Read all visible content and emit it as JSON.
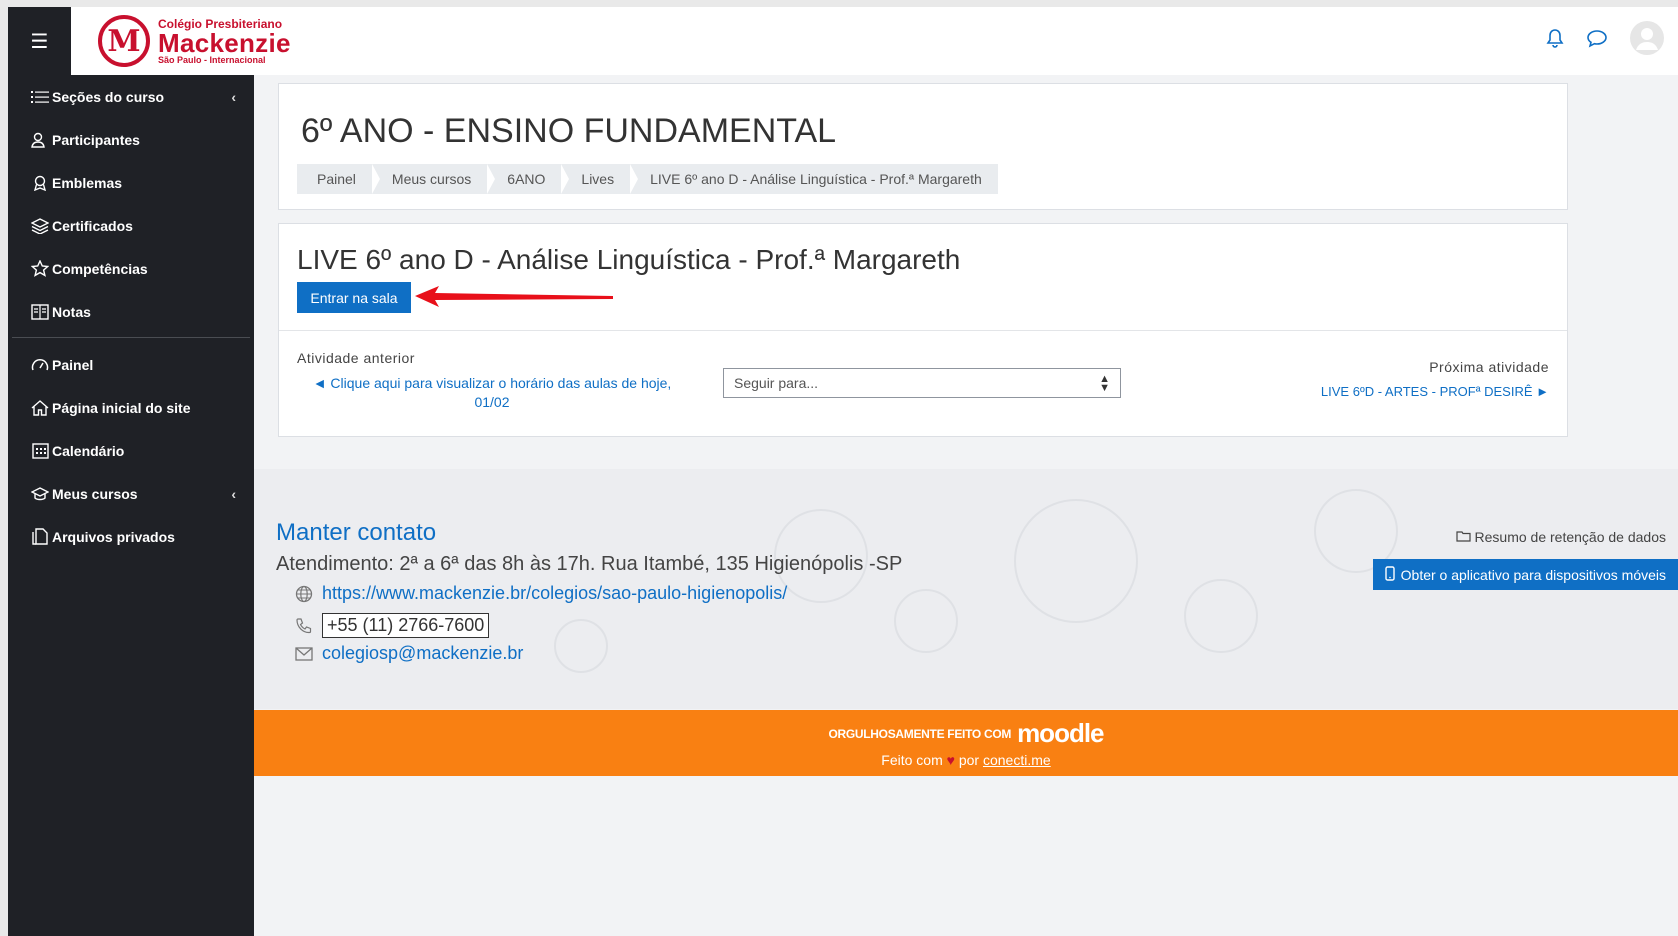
{
  "brand": {
    "logo_letter": "M",
    "line1": "Colégio Presbiteriano",
    "line2": "Mackenzie",
    "line3": "São Paulo - Internacional",
    "color": "#c8102e"
  },
  "navbar": {
    "menu_icon": "☰",
    "icons": [
      "bell-icon",
      "chat-icon",
      "user-avatar-icon"
    ]
  },
  "sidebar": {
    "items": [
      {
        "label": "Seções do curso",
        "icon": "list-icon",
        "has_chevron": true
      },
      {
        "label": "Participantes",
        "icon": "users-icon"
      },
      {
        "label": "Emblemas",
        "icon": "badge-icon"
      },
      {
        "label": "Certificados",
        "icon": "layers-icon"
      },
      {
        "label": "Competências",
        "icon": "star-icon"
      },
      {
        "label": "Notas",
        "icon": "book-icon"
      }
    ],
    "items2": [
      {
        "label": "Painel",
        "icon": "dashboard-icon"
      },
      {
        "label": "Página inicial do site",
        "icon": "home-icon"
      },
      {
        "label": "Calendário",
        "icon": "calendar-icon"
      },
      {
        "label": "Meus cursos",
        "icon": "graduation-cap-icon",
        "has_chevron": true
      },
      {
        "label": "Arquivos privados",
        "icon": "file-icon"
      }
    ],
    "chevron": "‹"
  },
  "header": {
    "title": "6º ANO - ENSINO FUNDAMENTAL",
    "breadcrumb": [
      "Painel",
      "Meus cursos",
      "6ANO",
      "Lives",
      "LIVE 6º ano D - Análise Linguística - Prof.ª Margareth"
    ]
  },
  "activity": {
    "title": "LIVE 6º ano D - Análise Linguística - Prof.ª Margareth",
    "enter_button": "Entrar na sala",
    "prev_label": "Atividade anterior",
    "prev_link": "◄ Clique aqui para visualizar o horário das aulas de hoje, 01/02",
    "jump_placeholder": "Seguir para...",
    "next_label": "Próxima atividade",
    "next_link": "LIVE 6ºD - ARTES - PROFª DESIRÊ ►"
  },
  "footer": {
    "contact_title": "Manter contato",
    "address": "Atendimento: 2ª a 6ª das 8h às 17h. Rua Itambé, 135 Higienópolis -SP",
    "website": "https://www.mackenzie.br/colegios/sao-paulo-higienopolis/",
    "phone": "+55 (11) 2766-7600",
    "email": "colegiosp@mackenzie.br",
    "retention": "Resumo de retenção de dados",
    "mobile_app": "Obter o aplicativo para dispositivos móveis",
    "made_with": "ORGULHOSAMENTE FEITO COM",
    "moodle": "moodle",
    "credits_prefix": "Feito com",
    "credits_heart": "♥",
    "credits_by": "por",
    "credits_link": "conecti.me"
  },
  "colors": {
    "accent": "#0f6fc5",
    "sidebar_bg": "#1f2126",
    "footer_bar": "#f98012",
    "annotation_arrow": "#e8101a"
  }
}
